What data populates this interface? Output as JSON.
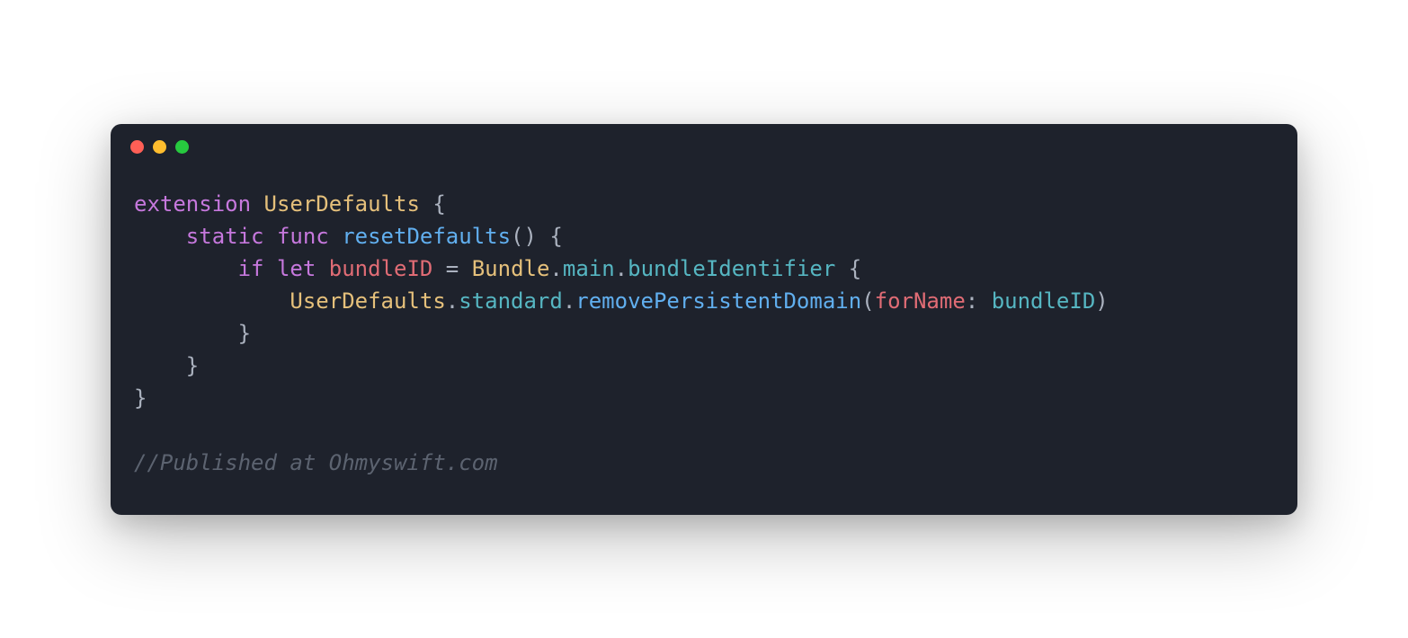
{
  "window": {
    "traffic_lights": {
      "close": "close",
      "minimize": "minimize",
      "maximize": "maximize"
    }
  },
  "code": {
    "line1": {
      "extension": "extension",
      "class": "UserDefaults",
      "brace": " {"
    },
    "line2": {
      "indent": "    ",
      "static": "static",
      "func": "func",
      "name": "resetDefaults",
      "parens_brace": "() {"
    },
    "line3": {
      "indent": "        ",
      "if": "if",
      "let": "let",
      "var": "bundleID",
      "equals": " = ",
      "bundle": "Bundle",
      "dot1": ".",
      "main": "main",
      "dot2": ".",
      "identifier": "bundleIdentifier",
      "brace": " {"
    },
    "line4": {
      "indent": "            ",
      "userdefaults": "UserDefaults",
      "dot1": ".",
      "standard": "standard",
      "dot2": ".",
      "method": "removePersistentDomain",
      "paren_open": "(",
      "forname": "forName",
      "colon": ": ",
      "bundleid": "bundleID",
      "paren_close": ")"
    },
    "line5": {
      "indent": "        ",
      "brace": "}"
    },
    "line6": {
      "indent": "    ",
      "brace": "}"
    },
    "line7": {
      "brace": "}"
    },
    "comment": "//Published at Ohmyswift.com"
  }
}
